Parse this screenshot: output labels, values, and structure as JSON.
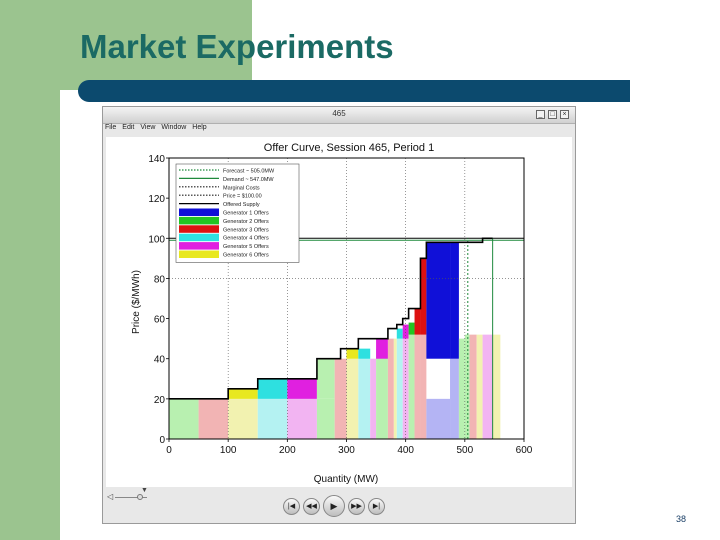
{
  "slide": {
    "title": "Market Experiments",
    "page_number": "38"
  },
  "window": {
    "title": "465",
    "buttons": [
      "_",
      "□",
      "×"
    ],
    "menu": [
      "File",
      "Edit",
      "View",
      "Window",
      "Help"
    ]
  },
  "player": {
    "buttons": [
      {
        "name": "skip-start-button",
        "glyph": "|◀"
      },
      {
        "name": "rewind-button",
        "glyph": "◀◀"
      },
      {
        "name": "play-button",
        "glyph": "▶"
      },
      {
        "name": "fast-forward-button",
        "glyph": "▶▶"
      },
      {
        "name": "skip-end-button",
        "glyph": "▶|"
      }
    ]
  },
  "chart_data": {
    "type": "area",
    "title": "Offer Curve, Session 465, Period 1",
    "xlabel": "Quantity (MW)",
    "ylabel": "Price ($/MWh)",
    "xlim": [
      0,
      600
    ],
    "ylim": [
      0,
      140
    ],
    "xticks": [
      0,
      100,
      200,
      300,
      400,
      500,
      600
    ],
    "yticks": [
      0,
      20,
      40,
      60,
      80,
      100,
      120,
      140
    ],
    "grid": "vertical dotted",
    "legend_position": "top-left",
    "legend": [
      {
        "label": "Forecast ~ 505.0MW",
        "color": "#1f8a3c",
        "style": "dotted"
      },
      {
        "label": "Demand ~ 547.0MW",
        "color": "#1f8a3c",
        "style": "solid"
      },
      {
        "label": "Marginal Costs",
        "color": "#222222",
        "style": "dotted"
      },
      {
        "label": "Price = $100.00",
        "color": "#222222",
        "style": "dotted"
      },
      {
        "label": "Offered Supply",
        "color": "#000000",
        "style": "solid"
      },
      {
        "label": "Generator 1 Offers",
        "color": "#1010d8",
        "style": "box"
      },
      {
        "label": "Generator 2 Offers",
        "color": "#22c522",
        "style": "box"
      },
      {
        "label": "Generator 3 Offers",
        "color": "#dd1111",
        "style": "box"
      },
      {
        "label": "Generator 4 Offers",
        "color": "#2ee0e0",
        "style": "box"
      },
      {
        "label": "Generator 5 Offers",
        "color": "#e020e0",
        "style": "box"
      },
      {
        "label": "Generator 6 Offers",
        "color": "#e8e820",
        "style": "box"
      }
    ],
    "hlines": [
      {
        "label": "Price = $100.00",
        "y": 100,
        "color": "#000000"
      },
      {
        "label": "Demand",
        "y": 99,
        "color": "#1f8a3c"
      }
    ],
    "vlines": [
      {
        "x": 505,
        "color": "#1f8a3c",
        "style": "dotted"
      },
      {
        "x": 547,
        "color": "#1f8a3c",
        "style": "solid"
      }
    ],
    "segments": [
      {
        "x0": 0,
        "x1": 50,
        "y": 20,
        "color": "#b8f0b0"
      },
      {
        "x0": 50,
        "x1": 100,
        "y": 20,
        "color": "#f2b4b4"
      },
      {
        "x0": 100,
        "x1": 150,
        "y": 20,
        "color": "#f2f2b0"
      },
      {
        "x0": 150,
        "x1": 200,
        "y": 20,
        "color": "#b4f2f2"
      },
      {
        "x0": 200,
        "x1": 250,
        "y": 20,
        "color": "#f2b4f2"
      },
      {
        "x0": 250,
        "x1": 280,
        "y": 20,
        "color": "#b8f0b0"
      },
      {
        "x0": 100,
        "x1": 150,
        "y0": 20,
        "y": 25,
        "color": "#e8e820"
      },
      {
        "x0": 150,
        "x1": 200,
        "y0": 20,
        "y": 30,
        "color": "#2ee0e0"
      },
      {
        "x0": 200,
        "x1": 250,
        "y0": 20,
        "y": 30,
        "color": "#e020e0"
      },
      {
        "x0": 250,
        "x1": 280,
        "y0": 20,
        "y": 40,
        "color": "#b8f0b0"
      },
      {
        "x0": 280,
        "x1": 300,
        "y": 40,
        "color": "#f2b4b4"
      },
      {
        "x0": 300,
        "x1": 320,
        "y": 40,
        "color": "#f2f2b0"
      },
      {
        "x0": 300,
        "x1": 320,
        "y0": 40,
        "y": 45,
        "color": "#e8e820"
      },
      {
        "x0": 320,
        "x1": 340,
        "y": 45,
        "color": "#b4f2f2"
      },
      {
        "x0": 320,
        "x1": 340,
        "y0": 40,
        "y": 45,
        "color": "#2ee0e0"
      },
      {
        "x0": 340,
        "x1": 350,
        "y": 40,
        "color": "#f2b4f2"
      },
      {
        "x0": 350,
        "x1": 370,
        "y": 45,
        "color": "#b8f0b0"
      },
      {
        "x0": 350,
        "x1": 370,
        "y0": 40,
        "y": 50,
        "color": "#e020e0"
      },
      {
        "x0": 370,
        "x1": 380,
        "y": 50,
        "color": "#f2b4b4"
      },
      {
        "x0": 380,
        "x1": 385,
        "y": 50,
        "color": "#f2f2b0"
      },
      {
        "x0": 385,
        "x1": 395,
        "y": 50,
        "color": "#b4f2f2"
      },
      {
        "x0": 385,
        "x1": 395,
        "y0": 50,
        "y": 55,
        "color": "#2ee0e0"
      },
      {
        "x0": 395,
        "x1": 405,
        "y": 50,
        "color": "#f2b4f2"
      },
      {
        "x0": 395,
        "x1": 405,
        "y0": 50,
        "y": 57,
        "color": "#e020e0"
      },
      {
        "x0": 405,
        "x1": 415,
        "y": 52,
        "color": "#b8f0b0"
      },
      {
        "x0": 405,
        "x1": 415,
        "y0": 52,
        "y": 58,
        "color": "#22c522"
      },
      {
        "x0": 415,
        "x1": 425,
        "y": 52,
        "color": "#f2b4b4"
      },
      {
        "x0": 415,
        "x1": 425,
        "y0": 52,
        "y": 65,
        "color": "#dd1111"
      },
      {
        "x0": 425,
        "x1": 435,
        "y": 52,
        "color": "#f2b4b4"
      },
      {
        "x0": 425,
        "x1": 435,
        "y0": 52,
        "y": 90,
        "color": "#dd1111"
      },
      {
        "x0": 435,
        "x1": 475,
        "y": 20,
        "color": "#b4b4f4"
      },
      {
        "x0": 435,
        "x1": 475,
        "y0": 40,
        "y": 98,
        "color": "#1010d8"
      },
      {
        "x0": 475,
        "x1": 490,
        "y": 40,
        "color": "#b4b4f4"
      },
      {
        "x0": 475,
        "x1": 490,
        "y0": 40,
        "y": 98,
        "color": "#1010d8"
      },
      {
        "x0": 490,
        "x1": 500,
        "y": 50,
        "color": "#b8f0b0"
      },
      {
        "x0": 500,
        "x1": 508,
        "y": 52,
        "color": "#b8f0b0"
      },
      {
        "x0": 508,
        "x1": 520,
        "y": 52,
        "color": "#f2b4b4"
      },
      {
        "x0": 520,
        "x1": 530,
        "y": 52,
        "color": "#f2f2b0"
      },
      {
        "x0": 530,
        "x1": 547,
        "y": 52,
        "color": "#f2b4f2"
      },
      {
        "x0": 547,
        "x1": 560,
        "y": 52,
        "color": "#f2f2b0"
      }
    ],
    "supply_curve": [
      [
        0,
        20
      ],
      [
        100,
        20
      ],
      [
        100,
        25
      ],
      [
        150,
        25
      ],
      [
        150,
        30
      ],
      [
        250,
        30
      ],
      [
        250,
        40
      ],
      [
        290,
        40
      ],
      [
        290,
        45
      ],
      [
        320,
        45
      ],
      [
        320,
        50
      ],
      [
        370,
        50
      ],
      [
        370,
        55
      ],
      [
        385,
        55
      ],
      [
        385,
        57
      ],
      [
        395,
        57
      ],
      [
        395,
        60
      ],
      [
        405,
        60
      ],
      [
        405,
        65
      ],
      [
        425,
        65
      ],
      [
        425,
        90
      ],
      [
        435,
        90
      ],
      [
        435,
        98
      ],
      [
        530,
        98
      ],
      [
        530,
        100
      ],
      [
        547,
        100
      ]
    ]
  }
}
